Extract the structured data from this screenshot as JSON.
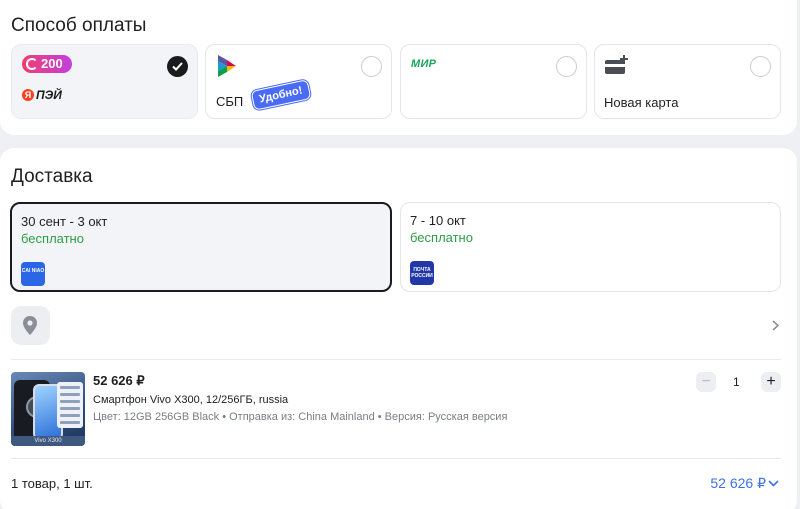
{
  "payment": {
    "title": "Способ оплаты",
    "options": [
      {
        "badge": "200",
        "sub_logo": "ПЭЙ",
        "icon": "ozon-points-icon",
        "selected": true
      },
      {
        "label": "СБП",
        "sticker": "Удобно!",
        "icon": "sbp-logo-icon",
        "selected": false
      },
      {
        "logo": "МИР",
        "icon": "mir-logo-icon",
        "selected": false
      },
      {
        "label": "Новая карта",
        "icon": "add-card-icon",
        "selected": false
      }
    ]
  },
  "delivery": {
    "title": "Доставка",
    "options": [
      {
        "dates": "30 сент - 3 окт",
        "price": "бесплатно",
        "carrier_icon": "cainiao-logo-icon",
        "carrier_text": "CAI NIAO",
        "selected": true
      },
      {
        "dates": "7 - 10 окт",
        "price": "бесплатно",
        "carrier_icon": "russian-post-logo-icon",
        "carrier_text": "ПОЧТА РОССИИ",
        "selected": false
      }
    ]
  },
  "product": {
    "price": "52 626 ₽",
    "name": "Смартфон Vivo X300, 12/256ГБ, russia",
    "attributes": "Цвет: 12GB 256GB Black • Отправка из: China Mainland • Версия: Русская версия",
    "image_caption": "Vivo X300",
    "quantity": "1",
    "minus_label": "−",
    "plus_label": "+"
  },
  "summary": {
    "count": "1 товар, 1 шт.",
    "total": "52 626 ₽"
  },
  "colors": {
    "accent": "#3f71e8",
    "free_delivery": "#2e9d45",
    "selected_border": "#1b1b1b"
  }
}
